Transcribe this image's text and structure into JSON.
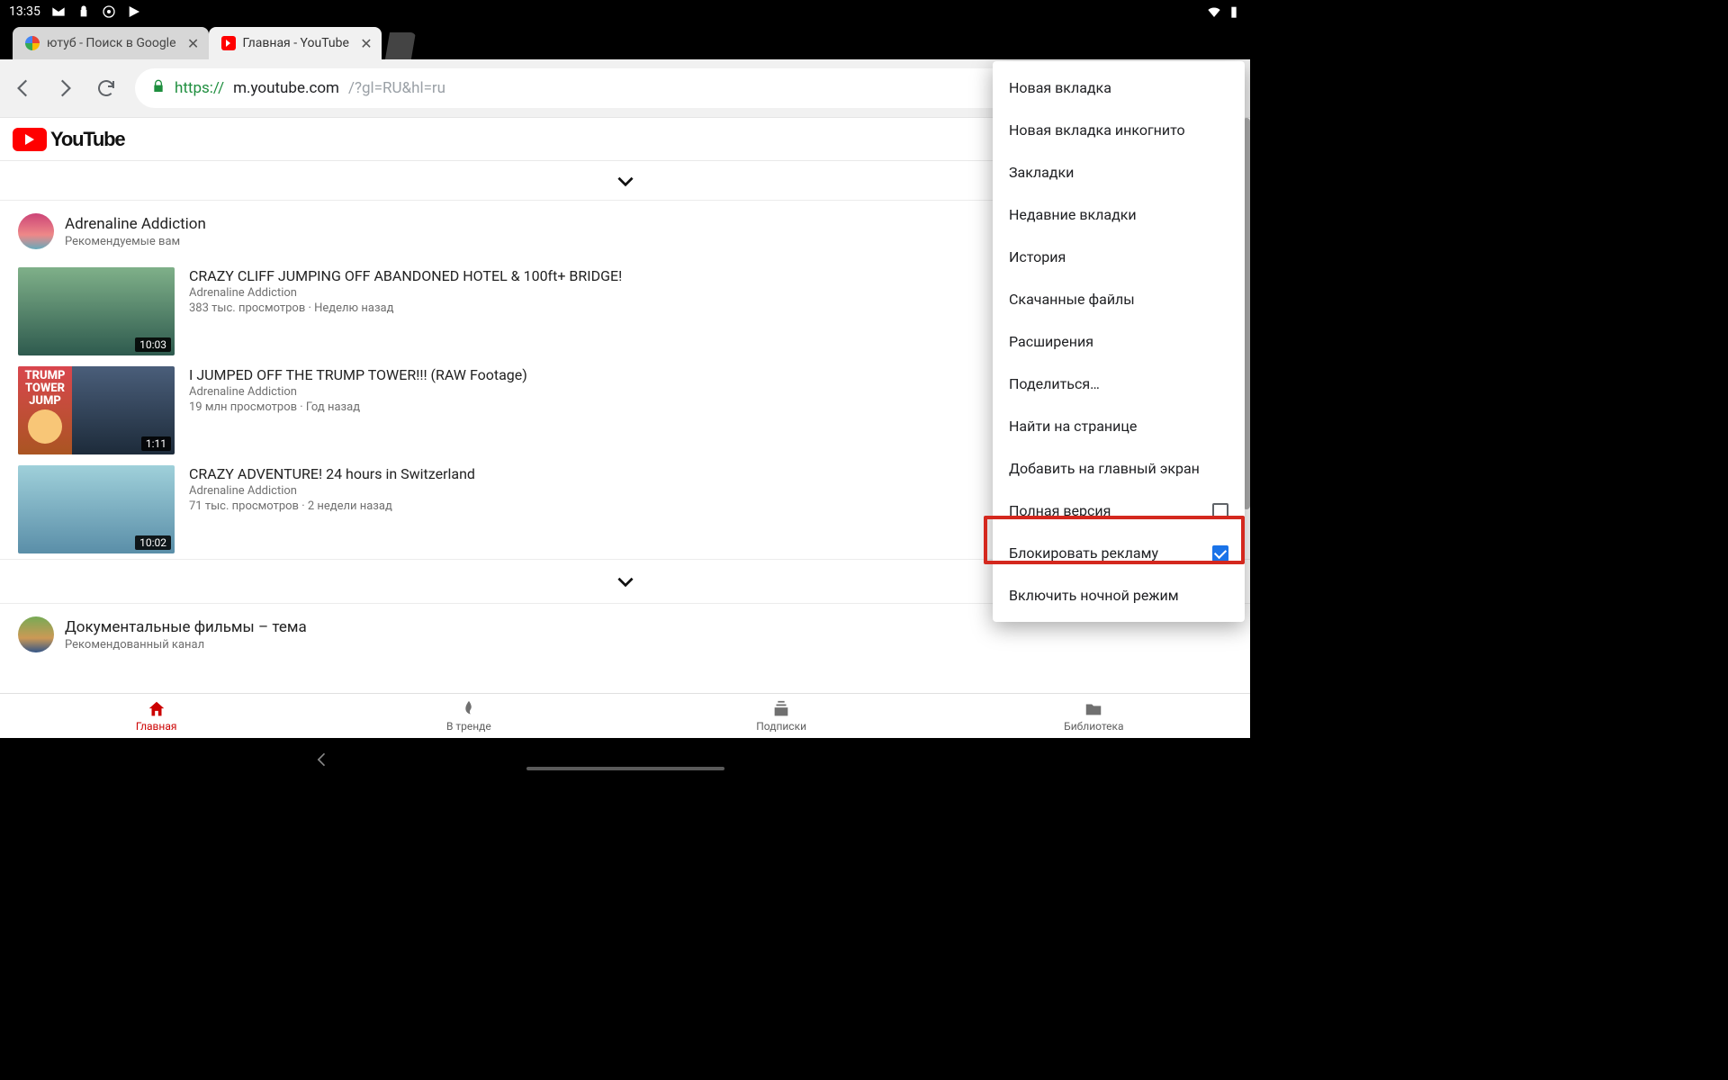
{
  "status": {
    "time": "13:35"
  },
  "tabs": [
    {
      "title": "ютуб - Поиск в Google",
      "active": false
    },
    {
      "title": "Главная - YouTube",
      "active": true
    }
  ],
  "url": {
    "https": "https://",
    "host": "m.youtube.com",
    "tail": "/?gl=RU&hl=ru"
  },
  "youtube": {
    "word": "YouTube"
  },
  "channel": {
    "name": "Adrenaline Addiction",
    "subtitle": "Рекомендуемые вам"
  },
  "videos": [
    {
      "title": "CRAZY CLIFF JUMPING OFF ABANDONED HOTEL & 100ft+ BRIDGE!",
      "channel": "Adrenaline Addiction",
      "views": "383 тыс. просмотров · Неделю назад",
      "duration": "10:03",
      "thumb_class": "t0"
    },
    {
      "title": "I JUMPED OFF THE TRUMP TOWER!!! (RAW Footage)",
      "channel": "Adrenaline Addiction",
      "views": "19 млн просмотров · Год назад",
      "duration": "1:11",
      "thumb_class": "t1",
      "tower_0": "TRUMP",
      "tower_1": "TOWER",
      "tower_2": "JUMP"
    },
    {
      "title": "CRAZY ADVENTURE! 24 hours in Switzerland",
      "channel": "Adrenaline Addiction",
      "views": "71 тыс. просмотров · 2 недели назад",
      "duration": "10:02",
      "thumb_class": "t2"
    }
  ],
  "section2": {
    "title": "Документальные фильмы – тема",
    "subtitle": "Рекомендованный канал"
  },
  "bottom_nav": [
    {
      "label": "Главная",
      "icon": "home",
      "active": true
    },
    {
      "label": "В тренде",
      "icon": "fire",
      "active": false
    },
    {
      "label": "Подписки",
      "icon": "subs",
      "active": false
    },
    {
      "label": "Библиотека",
      "icon": "folder",
      "active": false
    }
  ],
  "menu": [
    {
      "label": "Новая вкладка",
      "type": "plain"
    },
    {
      "label": "Новая вкладка инкогнито",
      "type": "plain"
    },
    {
      "label": "Закладки",
      "type": "plain"
    },
    {
      "label": "Недавние вкладки",
      "type": "plain"
    },
    {
      "label": "История",
      "type": "plain"
    },
    {
      "label": "Скачанные файлы",
      "type": "plain"
    },
    {
      "label": "Расширения",
      "type": "plain"
    },
    {
      "label": "Поделиться…",
      "type": "plain"
    },
    {
      "label": "Найти на странице",
      "type": "plain"
    },
    {
      "label": "Добавить на главный экран",
      "type": "plain"
    },
    {
      "label": "Полная версия",
      "type": "check",
      "checked": false
    },
    {
      "label": "Блокировать рекламу",
      "type": "check",
      "checked": true
    },
    {
      "label": "Включить ночной режим",
      "type": "plain"
    }
  ]
}
